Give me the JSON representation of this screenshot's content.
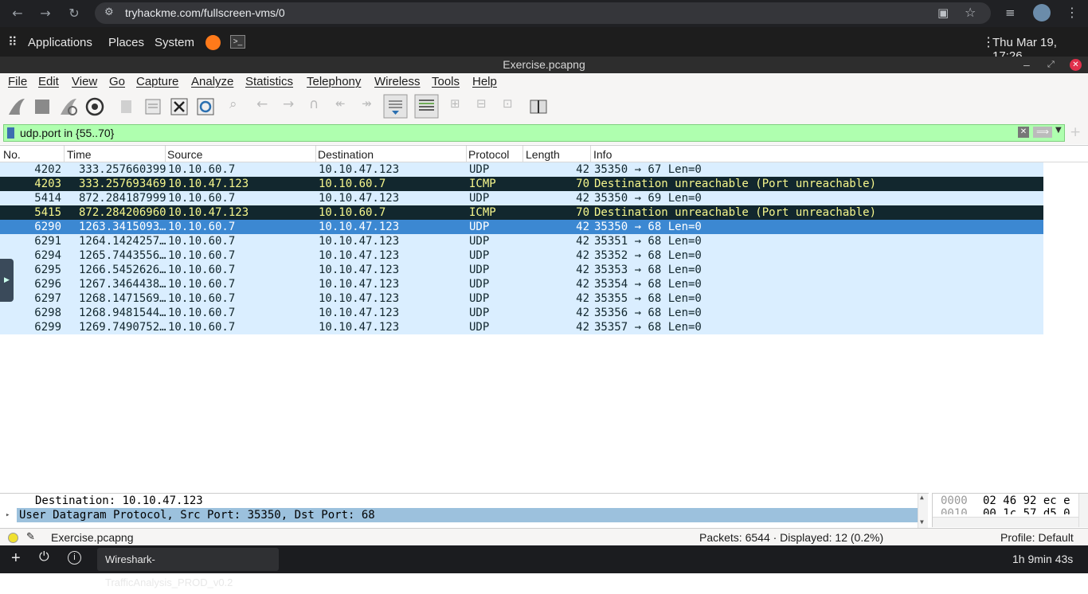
{
  "browser": {
    "url": "tryhackme.com/fullscreen-vms/0"
  },
  "panel": {
    "applications": "Applications",
    "places": "Places",
    "system": "System",
    "clock": "Thu Mar 19, 17:26"
  },
  "window": {
    "title": "Exercise.pcapng"
  },
  "menubar": {
    "file": "File",
    "edit": "Edit",
    "view": "View",
    "go": "Go",
    "capture": "Capture",
    "analyze": "Analyze",
    "statistics": "Statistics",
    "telephony": "Telephony",
    "wireless": "Wireless",
    "tools": "Tools",
    "help": "Help"
  },
  "filter": {
    "value": "udp.port in {55..70}"
  },
  "columns": {
    "no": "No.",
    "time": "Time",
    "source": "Source",
    "destination": "Destination",
    "protocol": "Protocol",
    "length": "Length",
    "info": "Info"
  },
  "packets": [
    {
      "no": "4202",
      "time": "333.257660399",
      "source": "10.10.60.7",
      "destination": "10.10.47.123",
      "protocol": "UDP",
      "length": "42",
      "info": "35350 → 67 Len=0"
    },
    {
      "no": "4203",
      "time": "333.257693469",
      "source": "10.10.47.123",
      "destination": "10.10.60.7",
      "protocol": "ICMP",
      "length": "70",
      "info": "Destination unreachable (Port unreachable)"
    },
    {
      "no": "5414",
      "time": "872.284187999",
      "source": "10.10.60.7",
      "destination": "10.10.47.123",
      "protocol": "UDP",
      "length": "42",
      "info": "35350 → 69 Len=0"
    },
    {
      "no": "5415",
      "time": "872.284206960",
      "source": "10.10.47.123",
      "destination": "10.10.60.7",
      "protocol": "ICMP",
      "length": "70",
      "info": "Destination unreachable (Port unreachable)"
    },
    {
      "no": "6290",
      "time": "1263.3415093…",
      "source": "10.10.60.7",
      "destination": "10.10.47.123",
      "protocol": "UDP",
      "length": "42",
      "info": "35350 → 68 Len=0"
    },
    {
      "no": "6291",
      "time": "1264.1424257…",
      "source": "10.10.60.7",
      "destination": "10.10.47.123",
      "protocol": "UDP",
      "length": "42",
      "info": "35351 → 68 Len=0"
    },
    {
      "no": "6294",
      "time": "1265.7443556…",
      "source": "10.10.60.7",
      "destination": "10.10.47.123",
      "protocol": "UDP",
      "length": "42",
      "info": "35352 → 68 Len=0"
    },
    {
      "no": "6295",
      "time": "1266.5452626…",
      "source": "10.10.60.7",
      "destination": "10.10.47.123",
      "protocol": "UDP",
      "length": "42",
      "info": "35353 → 68 Len=0"
    },
    {
      "no": "6296",
      "time": "1267.3464438…",
      "source": "10.10.60.7",
      "destination": "10.10.47.123",
      "protocol": "UDP",
      "length": "42",
      "info": "35354 → 68 Len=0"
    },
    {
      "no": "6297",
      "time": "1268.1471569…",
      "source": "10.10.60.7",
      "destination": "10.10.47.123",
      "protocol": "UDP",
      "length": "42",
      "info": "35355 → 68 Len=0"
    },
    {
      "no": "6298",
      "time": "1268.9481544…",
      "source": "10.10.60.7",
      "destination": "10.10.47.123",
      "protocol": "UDP",
      "length": "42",
      "info": "35356 → 68 Len=0"
    },
    {
      "no": "6299",
      "time": "1269.7490752…",
      "source": "10.10.60.7",
      "destination": "10.10.47.123",
      "protocol": "UDP",
      "length": "42",
      "info": "35357 → 68 Len=0"
    }
  ],
  "details": {
    "line1": "Destination: 10.10.47.123",
    "line2": "User Datagram Protocol, Src Port: 35350, Dst Port: 68"
  },
  "bytes": {
    "offset1": "0000",
    "hex1": "02 46 92 ec e",
    "offset2": "0010",
    "hex2": "00 1c 57 d5 0"
  },
  "status": {
    "file": "Exercise.pcapng",
    "packets": "Packets: 6544 · Displayed: 12 (0.2%)",
    "profile": "Profile: Default"
  },
  "taskbar": {
    "task": "Wireshark-TrafficAnalysis_PROD_v0.2",
    "timer": "1h 9min 43s"
  },
  "colors": {
    "udp_row": "#daeeff",
    "icmp_row": "#12272e",
    "selected_row": "#3c88d2",
    "filter_ok": "#afffaf"
  }
}
